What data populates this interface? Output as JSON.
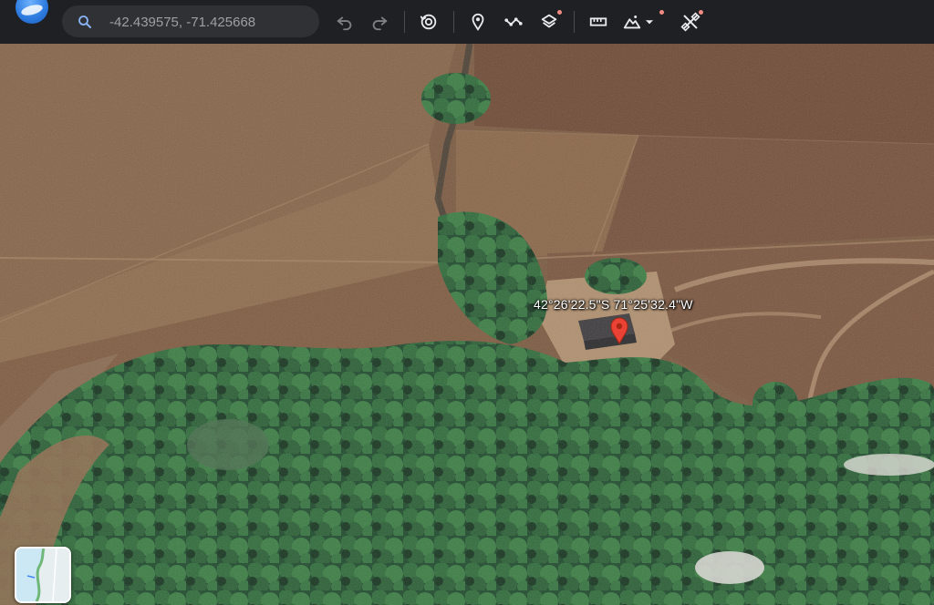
{
  "search": {
    "value": "-42.439575, -71.425668",
    "placeholder": ""
  },
  "marker": {
    "label": "42°26'22.5\"S 71°25'32.4\"W"
  },
  "colors": {
    "toolbar": "#1f2023",
    "search_bg": "#303134",
    "icon": "#e8eaed",
    "notify_dot": "#f28b82",
    "pin": "#ea4335"
  },
  "icons": {
    "logo": "google-earth-logo-icon",
    "search": "search-icon",
    "undo": "undo-icon",
    "redo": "redo-icon",
    "history": "historical-imagery-icon",
    "placemark": "placemark-icon",
    "path": "path-icon",
    "layers": "layers-icon",
    "measure": "ruler-icon",
    "view": "map-view-icon",
    "projects": "projects-icon"
  }
}
